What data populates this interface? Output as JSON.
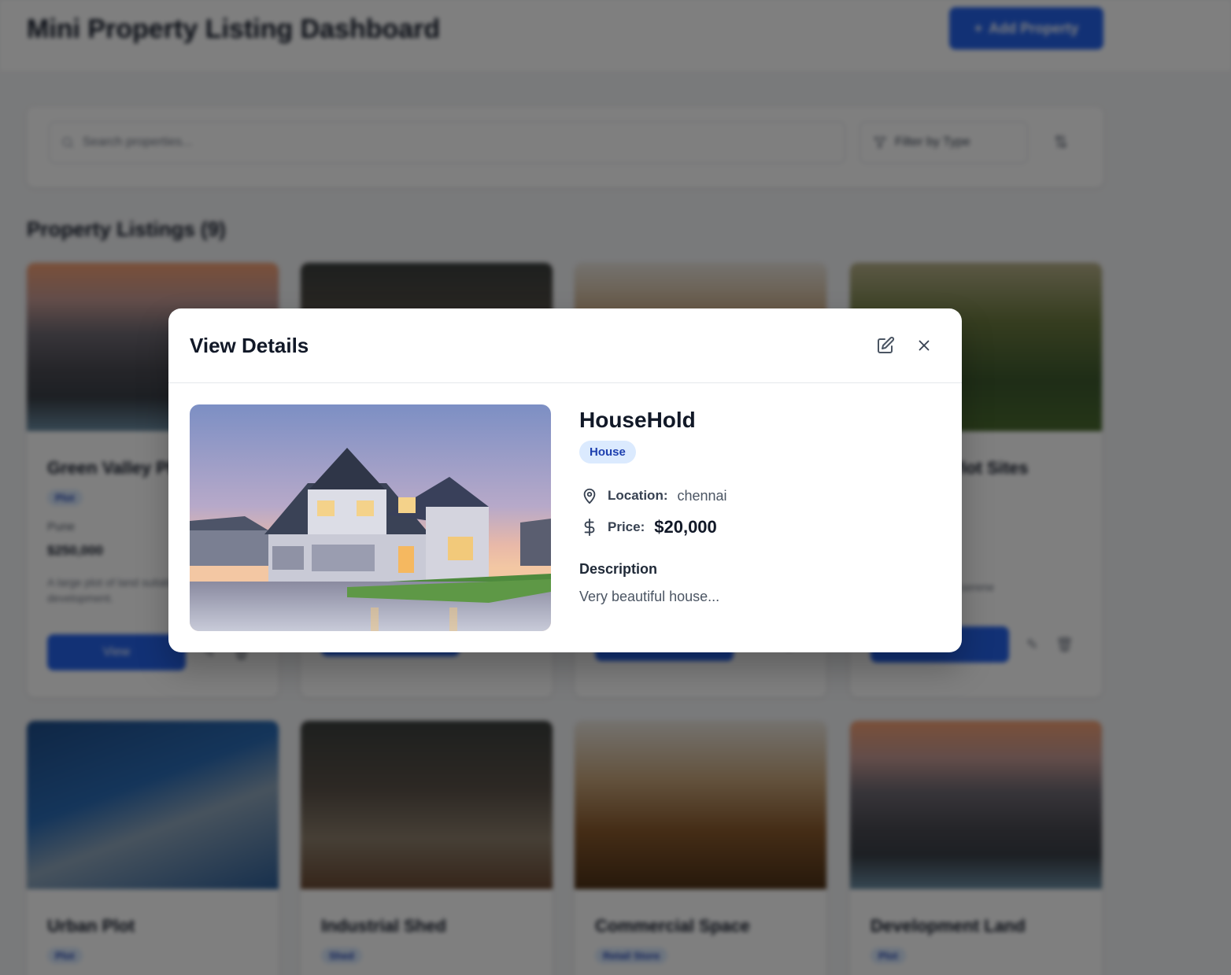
{
  "dashboard": {
    "title": "Mini Property Listing Dashboard",
    "add_button_label": "Add Property",
    "search_placeholder": "Search properties...",
    "filter_placeholder": "Filter by Type",
    "listings_heading": "Property Listings (9)",
    "view_label": "View",
    "cards": [
      {
        "title": "Green Valley Plot",
        "type": "Plot",
        "location": "Pune",
        "price": "$250,000",
        "description": "A large plot of land suitable for development."
      },
      {
        "title": "",
        "type": "",
        "location": "",
        "price": "",
        "description": ""
      },
      {
        "title": "",
        "type": "",
        "location": "",
        "price": "",
        "description": ""
      },
      {
        "title": "Lakeside Plot Sites",
        "type": "",
        "location": "",
        "price": "",
        "description": "Plots situated in a serene"
      },
      {
        "title": "Urban Plot",
        "type": "Plot"
      },
      {
        "title": "Industrial Shed",
        "type": "Shed"
      },
      {
        "title": "Commercial Space",
        "type": "Retail Store"
      },
      {
        "title": "Development Land",
        "type": "Plot"
      }
    ]
  },
  "modal": {
    "title": "View Details",
    "property": {
      "name": "HouseHold",
      "type": "House",
      "location_label": "Location:",
      "location": "chennai",
      "price_label": "Price:",
      "price": "$20,000",
      "description_label": "Description",
      "description": "Very beautiful house..."
    }
  },
  "icons": {
    "edit": "edit-icon",
    "close": "close-icon",
    "location": "map-pin-icon",
    "price": "dollar-icon",
    "search": "search-icon",
    "filter": "filter-icon",
    "sort": "sort-icon"
  },
  "colors": {
    "primary": "#2563eb",
    "badge_bg": "#dbeafe",
    "badge_text": "#1e40af"
  }
}
